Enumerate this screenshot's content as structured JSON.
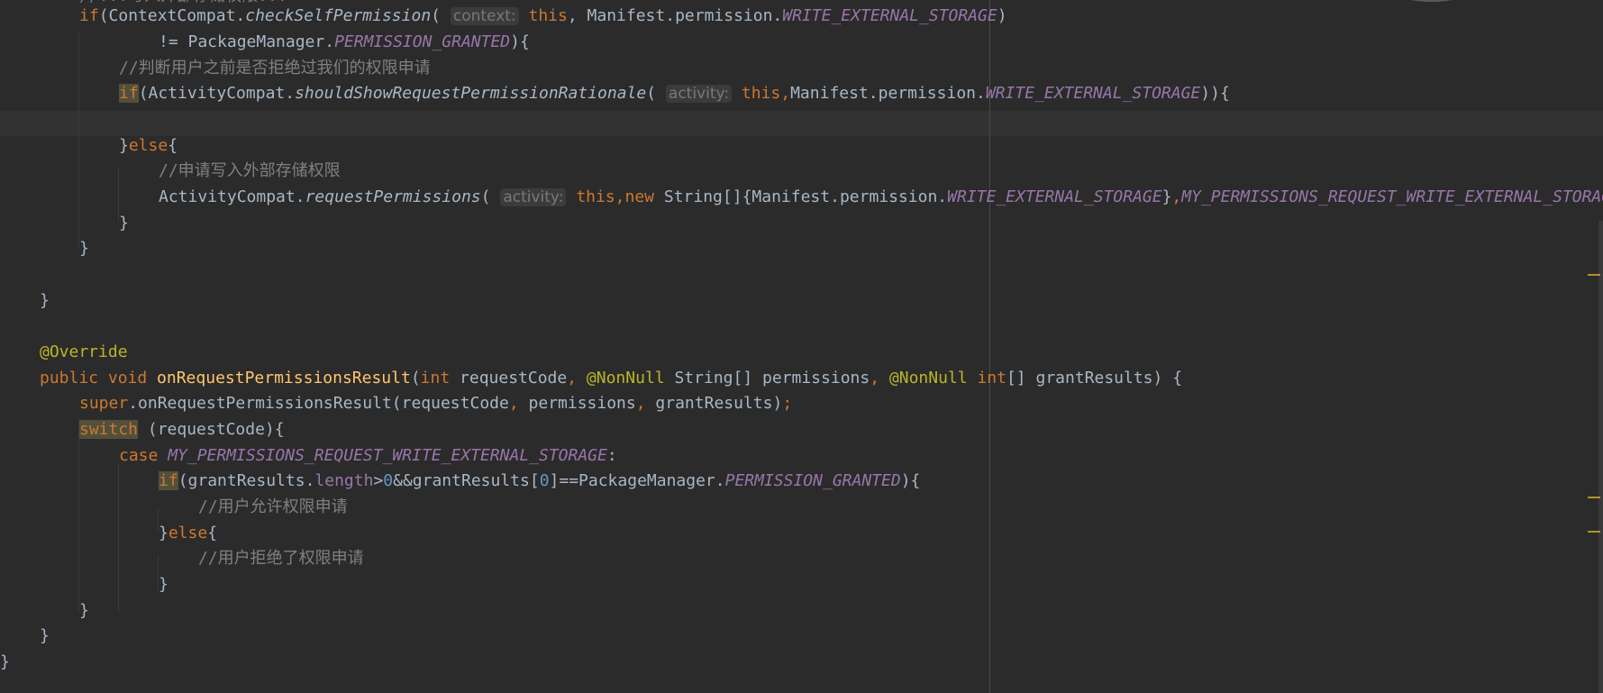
{
  "colors": {
    "background": "#2b2b2b",
    "current_line": "#323232",
    "keyword": "#cc7832",
    "static_field": "#9876aa",
    "method_declaration": "#ffc66d",
    "annotation": "#bbb529",
    "number": "#6897bb",
    "comment": "#808080",
    "default_text": "#a9b7c6",
    "inlay_hint": "#787878"
  },
  "editor": {
    "language": "Java",
    "top_cut_text": "//...写入外部存储权限...",
    "lines": [
      {
        "tokens": [
          {
            "t": "if",
            "c": "kw"
          },
          {
            "t": "(ContextCompat."
          },
          {
            "t": "checkSelfPermission",
            "c": "ital"
          },
          {
            "t": "( "
          },
          {
            "t": "context:",
            "c": "hint"
          },
          {
            "t": " "
          },
          {
            "t": "this",
            "c": "kw"
          },
          {
            "t": ", Manifest.permission."
          },
          {
            "t": "WRITE_EXTERNAL_STORAGE",
            "c": "field"
          },
          {
            "t": ")"
          }
        ]
      },
      {
        "tokens": [
          {
            "t": "!= PackageManager."
          },
          {
            "t": "PERMISSION_GRANTED",
            "c": "field"
          },
          {
            "t": "){"
          }
        ]
      },
      {
        "tokens": [
          {
            "t": "//判断用户之前是否拒绝过我们的权限申请",
            "c": "cmt"
          }
        ]
      },
      {
        "tokens": [
          {
            "t": "if",
            "c": "kwhl"
          },
          {
            "t": "(ActivityCompat."
          },
          {
            "t": "shouldShowRequestPermissionRationale",
            "c": "ital"
          },
          {
            "t": "( "
          },
          {
            "t": "activity:",
            "c": "hint"
          },
          {
            "t": " "
          },
          {
            "t": "this,",
            "c": "kw"
          },
          {
            "t": "Manifest.permission."
          },
          {
            "t": "WRITE_EXTERNAL_STORAGE",
            "c": "field"
          },
          {
            "t": ")){"
          }
        ]
      },
      {
        "tokens": []
      },
      {
        "tokens": [
          {
            "t": "}"
          },
          {
            "t": "else",
            "c": "kw"
          },
          {
            "t": "{"
          }
        ]
      },
      {
        "tokens": [
          {
            "t": "//申请写入外部存储权限",
            "c": "cmt"
          }
        ]
      },
      {
        "tokens": [
          {
            "t": "ActivityCompat."
          },
          {
            "t": "requestPermissions",
            "c": "ital"
          },
          {
            "t": "( "
          },
          {
            "t": "activity:",
            "c": "hint"
          },
          {
            "t": " "
          },
          {
            "t": "this,new ",
            "c": "kw"
          },
          {
            "t": "String[]{Manifest.permission."
          },
          {
            "t": "WRITE_EXTERNAL_STORAGE",
            "c": "field"
          },
          {
            "t": "}"
          },
          {
            "t": ",",
            "c": "kw"
          },
          {
            "t": "MY_PERMISSIONS_REQUEST_WRITE_EXTERNAL_STORAGE",
            "c": "field"
          }
        ]
      },
      {
        "tokens": [
          {
            "t": "}"
          }
        ]
      },
      {
        "tokens": [
          {
            "t": "}"
          }
        ]
      },
      {
        "tokens": []
      },
      {
        "tokens": [
          {
            "t": "}"
          }
        ]
      },
      {
        "tokens": []
      },
      {
        "tokens": [
          {
            "t": "@Override",
            "c": "ann"
          }
        ]
      },
      {
        "tokens": [
          {
            "t": "public void ",
            "c": "kw"
          },
          {
            "t": "onRequestPermissionsResult",
            "c": "meth"
          },
          {
            "t": "("
          },
          {
            "t": "int ",
            "c": "kw"
          },
          {
            "t": "requestCode"
          },
          {
            "t": ", ",
            "c": "kw"
          },
          {
            "t": "@NonNull ",
            "c": "ann"
          },
          {
            "t": "String[] permissions"
          },
          {
            "t": ", ",
            "c": "kw"
          },
          {
            "t": "@NonNull ",
            "c": "ann"
          },
          {
            "t": "int",
            "c": "kw"
          },
          {
            "t": "[] grantResults) {"
          }
        ]
      },
      {
        "tokens": [
          {
            "t": "super",
            "c": "kw"
          },
          {
            "t": ".onRequestPermissionsResult(requestCode"
          },
          {
            "t": ", ",
            "c": "kw"
          },
          {
            "t": "permissions"
          },
          {
            "t": ", ",
            "c": "kw"
          },
          {
            "t": "grantResults)"
          },
          {
            "t": ";",
            "c": "kw"
          }
        ]
      },
      {
        "tokens": [
          {
            "t": "switch",
            "c": "kwhl"
          },
          {
            "t": " (requestCode){"
          }
        ]
      },
      {
        "tokens": [
          {
            "t": "case ",
            "c": "kw"
          },
          {
            "t": "MY_PERMISSIONS_REQUEST_WRITE_EXTERNAL_STORAGE",
            "c": "field"
          },
          {
            "t": ":"
          }
        ]
      },
      {
        "tokens": [
          {
            "t": "if",
            "c": "kwhl"
          },
          {
            "t": "(grantResults."
          },
          {
            "t": "length",
            "c": "inst"
          },
          {
            "t": ">"
          },
          {
            "t": "0",
            "c": "num"
          },
          {
            "t": "&&grantResults["
          },
          {
            "t": "0",
            "c": "num"
          },
          {
            "t": "]==PackageManager."
          },
          {
            "t": "PERMISSION_GRANTED",
            "c": "field"
          },
          {
            "t": "){"
          }
        ]
      },
      {
        "tokens": [
          {
            "t": "//用户允许权限申请",
            "c": "cmt"
          }
        ]
      },
      {
        "tokens": [
          {
            "t": "}"
          },
          {
            "t": "else",
            "c": "kw"
          },
          {
            "t": "{"
          }
        ]
      },
      {
        "tokens": [
          {
            "t": "//用户拒绝了权限申请",
            "c": "cmt"
          }
        ]
      },
      {
        "tokens": [
          {
            "t": "}"
          }
        ]
      },
      {
        "tokens": [
          {
            "t": "}"
          }
        ]
      },
      {
        "tokens": [
          {
            "t": "}"
          }
        ]
      },
      {
        "tokens": [
          {
            "t": "}"
          }
        ]
      }
    ]
  }
}
